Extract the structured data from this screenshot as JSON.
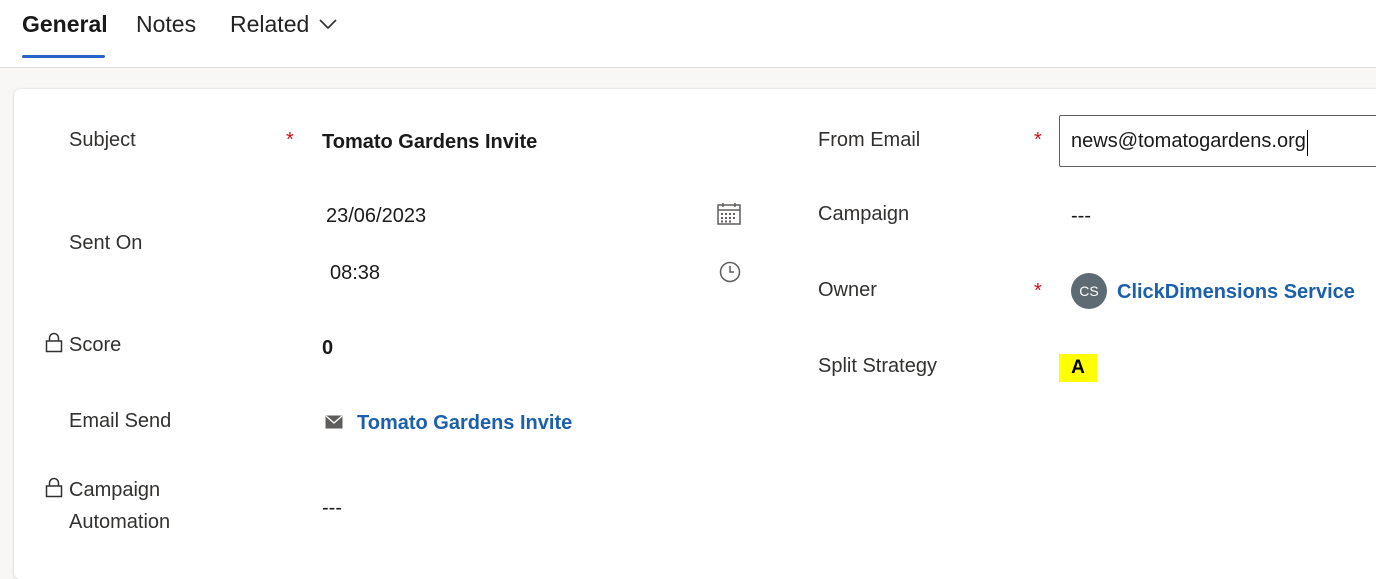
{
  "tabs": [
    {
      "label": "General"
    },
    {
      "label": "Notes"
    },
    {
      "label": "Related"
    }
  ],
  "colors": {
    "accent": "#2b62c6",
    "link": "#1c5fab",
    "required": "#c50f1f",
    "highlight": "#ffff00",
    "avatar_bg": "#5e6b73"
  },
  "form": {
    "subject": {
      "label": "Subject",
      "required": "*",
      "value": "Tomato Gardens Invite"
    },
    "sent_on": {
      "label": "Sent On",
      "date": "23/06/2023",
      "time": "08:38"
    },
    "score": {
      "label": "Score",
      "value": "0"
    },
    "email_send": {
      "label": "Email Send",
      "value": "Tomato Gardens Invite"
    },
    "campaign_automation": {
      "label_line1": "Campaign",
      "label_line2": "Automation",
      "value": "---"
    },
    "from_email": {
      "label": "From Email",
      "required": "*",
      "value": "news@tomatogardens.org"
    },
    "campaign": {
      "label": "Campaign",
      "value": "---"
    },
    "owner": {
      "label": "Owner",
      "required": "*",
      "initials": "CS",
      "value": "ClickDimensions Service"
    },
    "split_strategy": {
      "label": "Split Strategy",
      "value": "A"
    }
  },
  "icons": [
    "chevron-down-icon",
    "calendar-icon",
    "clock-icon",
    "lock-icon",
    "email-icon"
  ]
}
